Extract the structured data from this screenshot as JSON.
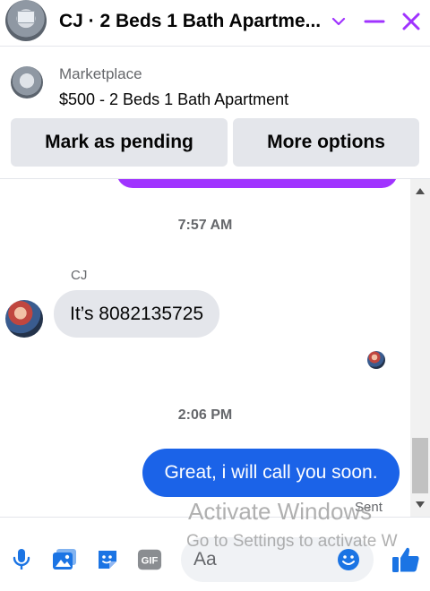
{
  "header": {
    "title": "CJ · 2 Beds 1 Bath Apartme...",
    "icons": [
      "chevron-down-icon",
      "minimize-icon",
      "close-icon"
    ],
    "accent_color": "#a033ff"
  },
  "marketplace": {
    "label": "Marketplace",
    "listing": "$500 - 2 Beds 1 Bath Apartment",
    "buttons": {
      "pending": "Mark as pending",
      "more": "More options"
    }
  },
  "conversation": {
    "timestamp_1": "7:57 AM",
    "sender_name": "CJ",
    "incoming_message": "It’s 8082135725",
    "timestamp_2": "2:06 PM",
    "outgoing_message": "Great, i will call you soon.",
    "status": "Sent",
    "outgoing_color": "#1b63e8",
    "incoming_color": "#e4e6eb"
  },
  "footer": {
    "input_placeholder": "Aa",
    "gif_label": "GIF",
    "icons": [
      "microphone-icon",
      "photo-icon",
      "sticker-icon",
      "gif-icon",
      "emoji-icon",
      "thumbs-up-icon"
    ],
    "icon_color": "#1b74e4"
  },
  "watermark": {
    "line1": "Activate Windows",
    "line2": "Go to Settings to activate W"
  }
}
